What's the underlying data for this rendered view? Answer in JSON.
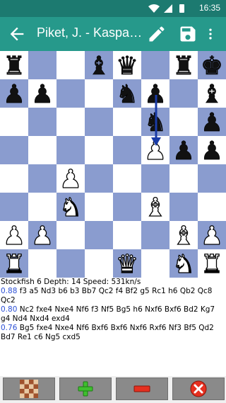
{
  "status_bar": {
    "time": "16:35",
    "icons": [
      "wifi-icon",
      "signal-icon",
      "battery-icon"
    ]
  },
  "app_bar": {
    "title": "Piket, J. - Kasparov",
    "icons": [
      "back-arrow-icon",
      "pencil-icon",
      "save-icon",
      "more-vert-icon"
    ],
    "color": "#26998b"
  },
  "board": {
    "light_color": "#ffffff",
    "dark_color": "#8a9ccf",
    "highlight_color": "#1a3ba6",
    "ranks": [
      [
        "bR",
        "",
        "",
        "bB",
        "bQ",
        "",
        "bR",
        "bK",
        ""
      ],
      [
        "bP",
        "bP",
        "",
        "",
        "bN",
        "bP",
        "",
        "bB",
        "bP"
      ],
      [
        "",
        "",
        "",
        "",
        "",
        "bN",
        "",
        "bP",
        ""
      ],
      [
        "",
        "",
        "",
        "",
        "",
        "wP",
        "bP",
        "bP",
        ""
      ],
      [
        "",
        "",
        "wP",
        "",
        "",
        "",
        "",
        "",
        ""
      ],
      [
        "",
        "",
        "wN",
        "",
        "",
        "wB",
        "",
        "",
        ""
      ],
      [
        "wP",
        "wP",
        "",
        "",
        "",
        "",
        "wB",
        "wP",
        "wP"
      ],
      [
        "wR",
        "",
        "",
        "",
        "wQ",
        "",
        "wN",
        "wR",
        "wK"
      ]
    ],
    "last_move": {
      "from": "g7",
      "to": "g5"
    }
  },
  "engine": {
    "header": "Stockfish 6 Depth: 14 Speed: 531kn/s",
    "lines": [
      {
        "score": "0.88",
        "moves": "f3 a5 Nd3 b6 b3 Bb7 Qc2 f4 Bf2 g5 Rc1 h6 Qb2 Qc8 Qc2"
      },
      {
        "score": "0.80",
        "moves": "Nc2 fxe4 Nxe4 Nf6 f3 Nf5 Bg5 h6 Nxf6 Bxf6 Bd2 Kg7 g4 Nd4 Nxd4 exd4"
      },
      {
        "score": "0.76",
        "moves": "Bg5 fxe4 Nxe4 Nf6 Bxf6 Bxf6 Nxf6 Rxf6 Nf3 Bf5 Qd2 Bd7 Re1 c6 Ng5 cxd5"
      }
    ]
  },
  "bottom_bar": {
    "buttons": [
      "board-mode-button",
      "add-button",
      "remove-button",
      "cancel-button"
    ]
  }
}
